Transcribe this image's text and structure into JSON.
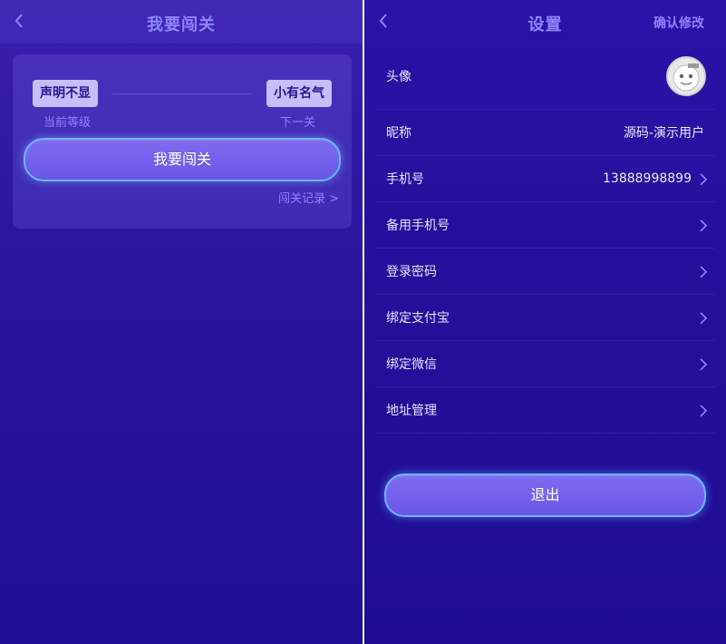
{
  "left": {
    "title": "我要闯关",
    "current_level": "声明不显",
    "next_level": "小有名气",
    "current_caption": "当前等级",
    "next_caption": "下一关",
    "challenge_button": "我要闯关",
    "record_link": "闯关记录 >"
  },
  "right": {
    "title": "设置",
    "confirm": "确认修改",
    "rows": [
      {
        "label": "头像"
      },
      {
        "label": "昵称",
        "value": "源码-演示用户"
      },
      {
        "label": "手机号",
        "value": "13888998899"
      },
      {
        "label": "备用手机号"
      },
      {
        "label": "登录密码"
      },
      {
        "label": "绑定支付宝"
      },
      {
        "label": "绑定微信"
      },
      {
        "label": "地址管理"
      }
    ],
    "logout": "退出"
  },
  "colors": {
    "accent": "#8f84ff",
    "badge": "#c6bdfd",
    "button": "#6a56e6",
    "button_border": "#6bb2ff"
  },
  "icons": [
    "back-icon",
    "chevron-right-icon",
    "avatar"
  ]
}
